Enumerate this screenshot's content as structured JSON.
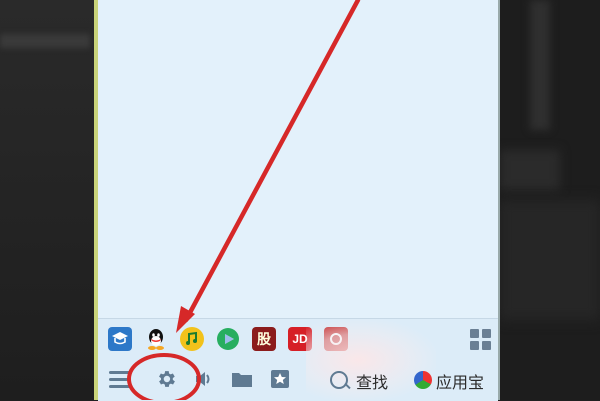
{
  "taskbar": {
    "top_row": [
      {
        "name": "classroom",
        "glyph": "⛟"
      },
      {
        "name": "qq",
        "glyph": "🐧"
      },
      {
        "name": "qq-music",
        "glyph": "♫"
      },
      {
        "name": "video",
        "glyph": "▶"
      },
      {
        "name": "stock",
        "glyph": "股"
      },
      {
        "name": "jd",
        "glyph": "JD"
      },
      {
        "name": "red-app",
        "glyph": "⊕"
      }
    ],
    "bottom_row": {
      "search_label": "查找",
      "appstore_label": "应用宝"
    }
  },
  "annotation": {
    "arrow_color": "#d62828",
    "circle_color": "#d62828",
    "highlighted": "settings-gear"
  }
}
